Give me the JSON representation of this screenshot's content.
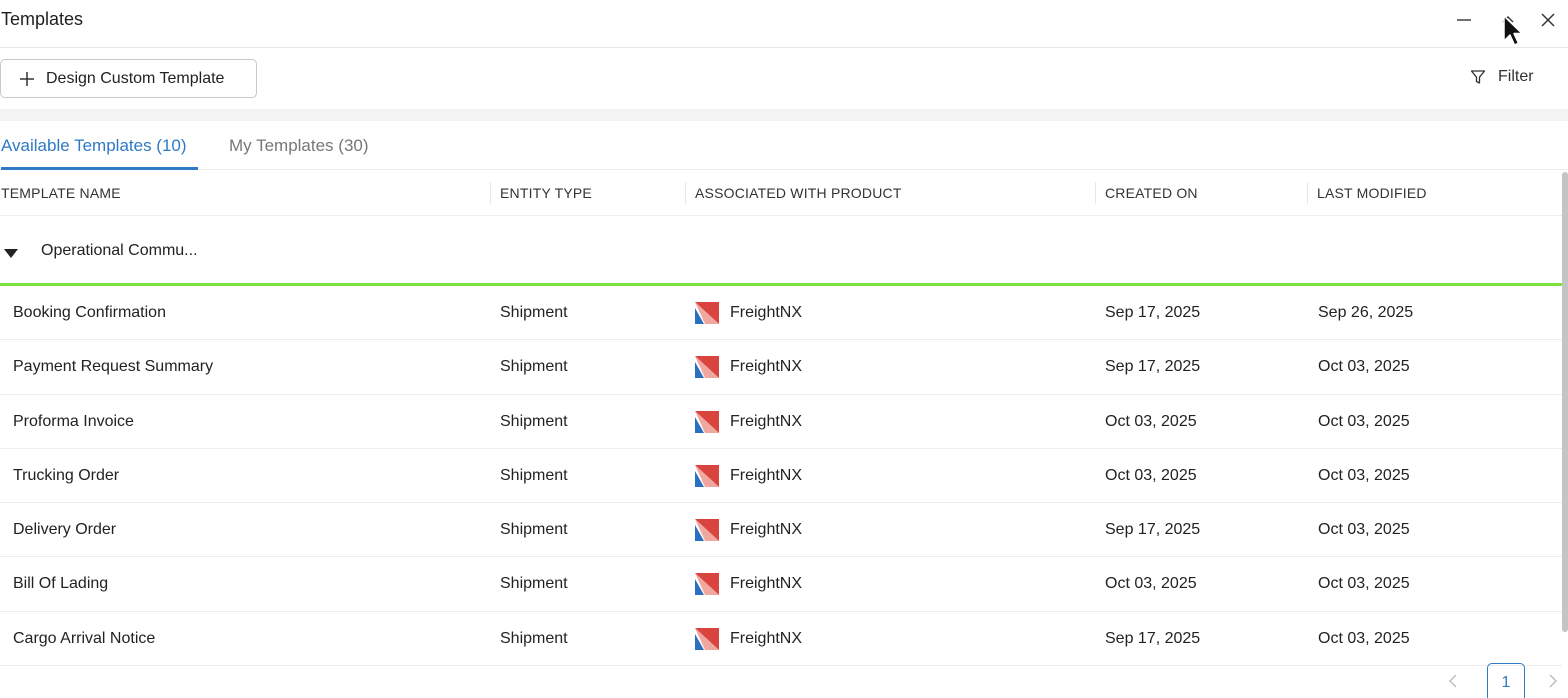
{
  "window": {
    "title": "Templates"
  },
  "toolbar": {
    "design_label": "Design Custom Template",
    "filter_label": "Filter"
  },
  "tabs": [
    {
      "label": "Available Templates (10)",
      "active": true
    },
    {
      "label": "My Templates (30)",
      "active": false
    }
  ],
  "table": {
    "columns": [
      "TEMPLATE NAME",
      "ENTITY TYPE",
      "ASSOCIATED WITH PRODUCT",
      "CREATED ON",
      "LAST MODIFIED"
    ],
    "group": {
      "label": "Operational Commu...",
      "expanded": true
    },
    "rows": [
      {
        "name": "Booking Confirmation",
        "entity": "Shipment",
        "product": "FreightNX",
        "created": "Sep 17, 2025",
        "modified": "Sep 26, 2025"
      },
      {
        "name": "Payment Request Summary",
        "entity": "Shipment",
        "product": "FreightNX",
        "created": "Sep 17, 2025",
        "modified": "Oct 03, 2025"
      },
      {
        "name": "Proforma Invoice",
        "entity": "Shipment",
        "product": "FreightNX",
        "created": "Oct 03, 2025",
        "modified": "Oct 03, 2025"
      },
      {
        "name": "Trucking Order",
        "entity": "Shipment",
        "product": "FreightNX",
        "created": "Oct 03, 2025",
        "modified": "Oct 03, 2025"
      },
      {
        "name": "Delivery Order",
        "entity": "Shipment",
        "product": "FreightNX",
        "created": "Sep 17, 2025",
        "modified": "Oct 03, 2025"
      },
      {
        "name": "Bill Of Lading",
        "entity": "Shipment",
        "product": "FreightNX",
        "created": "Oct 03, 2025",
        "modified": "Oct 03, 2025"
      },
      {
        "name": "Cargo Arrival Notice",
        "entity": "Shipment",
        "product": "FreightNX",
        "created": "Sep 17, 2025",
        "modified": "Oct 03, 2025"
      }
    ]
  },
  "pagination": {
    "current_page": "1"
  },
  "colors": {
    "accent": "#2f7ac4",
    "group_highlight": "#7ee13c",
    "logo_red": "#d9443f",
    "logo_blue": "#2a6fc0"
  },
  "icons": {
    "minimize": "minimize-icon",
    "maximize": "maximize-icon",
    "close": "close-icon",
    "plus": "plus-icon",
    "filter": "funnel-icon",
    "group_toggle": "caret-down-icon",
    "product_logo": "freightnx-logo-icon",
    "prev": "chevron-left-icon",
    "next": "chevron-right-icon"
  }
}
